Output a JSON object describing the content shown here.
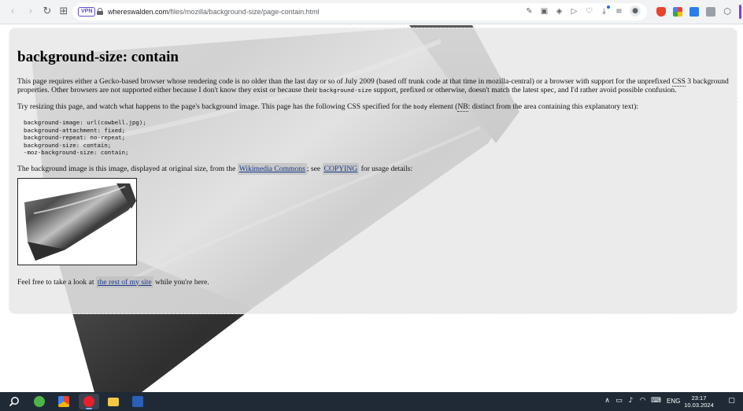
{
  "browser": {
    "vpn_label": "VPN",
    "url_host": "whereswalden.com",
    "url_path": "/files/mozilla/background-size/page-contain.html",
    "icons": {
      "back": "arrow-left-icon",
      "forward": "arrow-right-icon",
      "reload": "reload-icon",
      "tabs": "tabs-grid-icon",
      "lock": "lock-icon"
    }
  },
  "page": {
    "title": "background-size: contain",
    "intro_before_abbr": "This page requires either a Gecko-based browser whose rendering code is no older than the last day or so of July 2009 (based off trunk code at that time in mozilla-central) or a browser with support for the unprefixed ",
    "intro_abbr": "CSS",
    "intro_after_abbr": " 3 background properties. Other browsers are not supported either because I don't know they exist or because their ",
    "intro_code": "background-size",
    "intro_end": " support, prefixed or otherwise, doesn't match the latest spec, and I'd rather avoid possible confusion.",
    "resize_before_code": "Try resizing this page, and watch what happens to the page's background image. This page has the following CSS specified for the ",
    "resize_code": "body",
    "resize_mid": " element (",
    "resize_abbr": "NB",
    "resize_end": ": distinct from the area containing this explanatory text):",
    "css_lines": [
      "background-image: url(cowbell.jpg);",
      "background-attachment: fixed;",
      "background-repeat: no-repeat;",
      "background-size: contain;",
      "-moz-background-size: contain;"
    ],
    "image_before_link": "The background image is this image, displayed at original size, from the ",
    "wikimedia_link": "Wikimedia Commons",
    "image_mid": "; see ",
    "copying_link": "COPYING",
    "image_end": " for usage details:",
    "footer_before_link": "Feel free to take a look at ",
    "site_link": "the rest of my site",
    "footer_end": " while you're here."
  },
  "taskbar": {
    "lang": "ENG",
    "time": "23:17",
    "date": "10.03.2024",
    "apps": [
      "search-icon",
      "utorrent-icon",
      "paint-icon",
      "opera-icon",
      "file-explorer-icon",
      "word-icon"
    ]
  },
  "colors": {
    "accent": "#5a4fcf",
    "taskbar": "#1f2a36",
    "link": "#1a3a8a"
  }
}
